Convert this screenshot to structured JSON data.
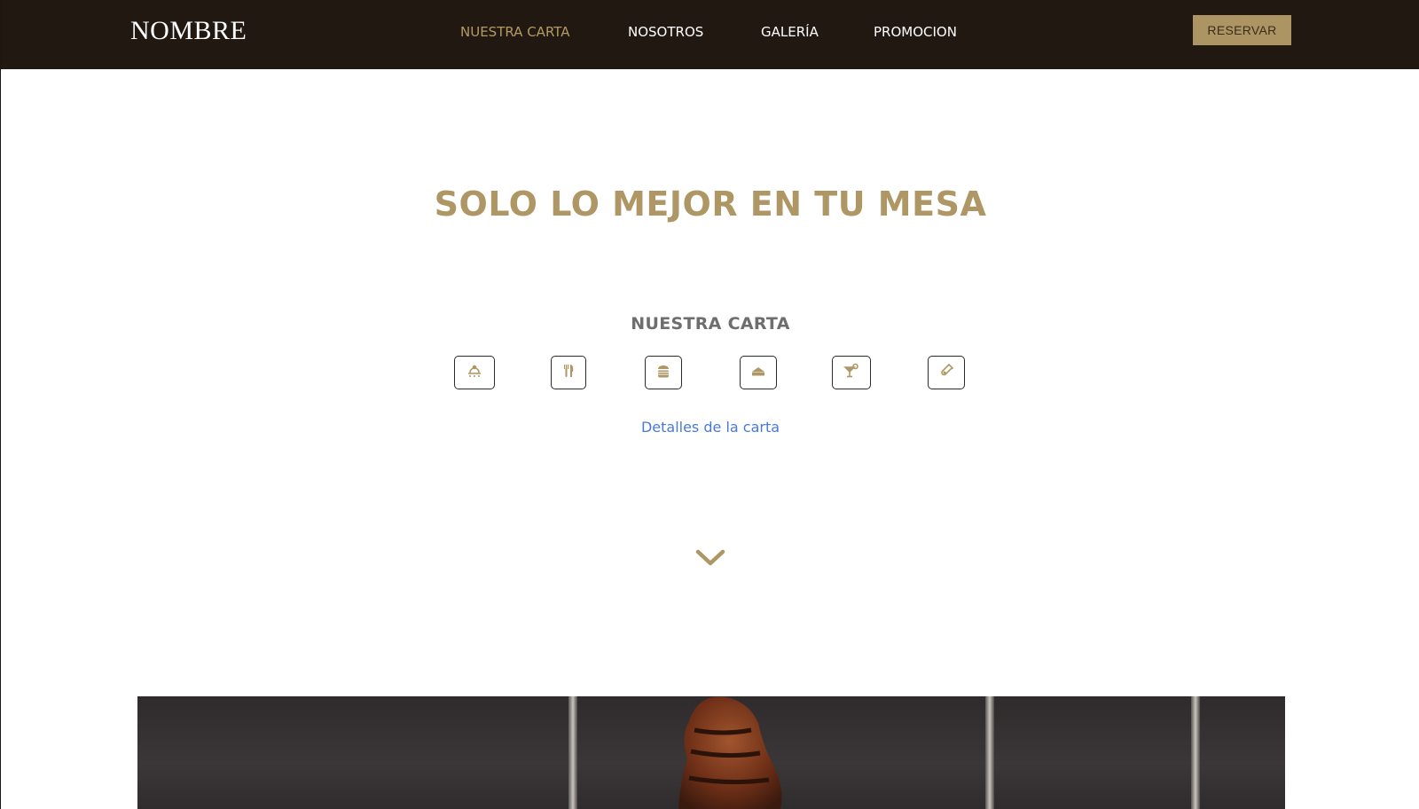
{
  "header": {
    "brand": "NOMBRE",
    "nav": [
      {
        "label": "NUESTRA CARTA",
        "active": true
      },
      {
        "label": "NOSOTROS",
        "active": false
      },
      {
        "label": "GALERÍA",
        "active": false
      },
      {
        "label": "PROMOCION",
        "active": false
      }
    ],
    "reserve_label": "RESERVAR"
  },
  "hero": {
    "title": "SOLO LO MEJOR EN TU MESA"
  },
  "menu": {
    "heading": "NUESTRA CARTA",
    "categories": [
      {
        "icon": "grill-icon"
      },
      {
        "icon": "fork-knife-icon"
      },
      {
        "icon": "burger-icon"
      },
      {
        "icon": "cake-icon"
      },
      {
        "icon": "cocktail-icon"
      },
      {
        "icon": "wine-bottle-icon"
      }
    ],
    "details_link": "Detalles de la carta"
  },
  "colors": {
    "topbar": "#221812",
    "accent": "#ae9765",
    "link": "#4a79d9"
  }
}
